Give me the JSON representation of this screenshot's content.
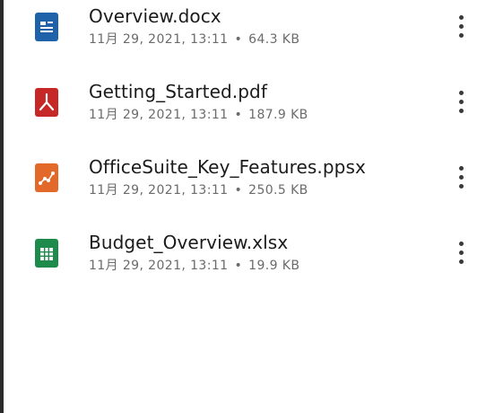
{
  "files": [
    {
      "name": "Overview.docx",
      "date": "11月 29, 2021, 13:11",
      "separator": "•",
      "size": "64.3 KB",
      "icon": "doc-icon",
      "color": "#1f62a9"
    },
    {
      "name": "Getting_Started.pdf",
      "date": "11月 29, 2021, 13:11",
      "separator": "•",
      "size": "187.9 KB",
      "icon": "pdf-icon",
      "color": "#c62828"
    },
    {
      "name": "OfficeSuite_Key_Features.ppsx",
      "date": "11月 29, 2021, 13:11",
      "separator": "•",
      "size": "250.5 KB",
      "icon": "slides-icon",
      "color": "#e2692a"
    },
    {
      "name": "Budget_Overview.xlsx",
      "date": "11月 29, 2021, 13:11",
      "separator": "•",
      "size": "19.9 KB",
      "icon": "sheet-icon",
      "color": "#1e8a4c"
    }
  ]
}
